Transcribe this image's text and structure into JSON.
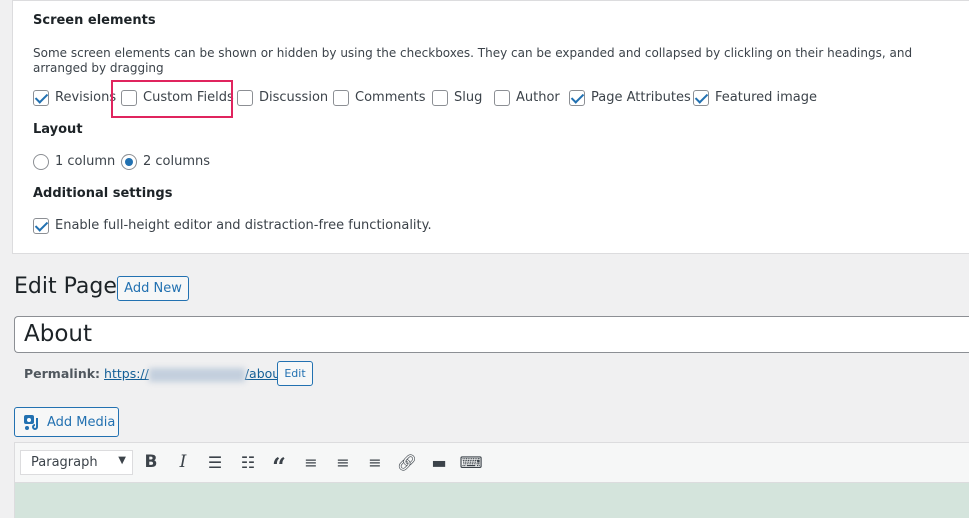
{
  "screen_options": {
    "title": "Screen elements",
    "description": "Some screen elements can be shown or hidden by using the checkboxes. They can be expanded and collapsed by clickling on their headings, and arranged by dragging",
    "elements": [
      {
        "label": "Revisions",
        "checked": true
      },
      {
        "label": "Custom Fields",
        "checked": false,
        "highlighted": true
      },
      {
        "label": "Discussion",
        "checked": false
      },
      {
        "label": "Comments",
        "checked": false
      },
      {
        "label": "Slug",
        "checked": false
      },
      {
        "label": "Author",
        "checked": false
      },
      {
        "label": "Page Attributes",
        "checked": true
      },
      {
        "label": "Featured image",
        "checked": true
      }
    ],
    "layout_title": "Layout",
    "layout_options": [
      {
        "label": "1 column",
        "selected": false
      },
      {
        "label": "2 columns",
        "selected": true
      }
    ],
    "additional_title": "Additional settings",
    "additional": {
      "label": "Enable full-height editor and distraction-free functionality.",
      "checked": true
    }
  },
  "editor": {
    "heading": "Edit Page",
    "add_new": "Add New",
    "title_value": "About",
    "permalink_label": "Permalink:",
    "permalink_prefix": "https://",
    "permalink_suffix": "/about/",
    "edit_label": "Edit",
    "add_media": "Add Media",
    "format_select": "Paragraph",
    "toolbar_icons": [
      "bold-icon",
      "italic-icon",
      "bulleted-list-icon",
      "numbered-list-icon",
      "blockquote-icon",
      "align-left-icon",
      "align-center-icon",
      "align-right-icon",
      "link-icon",
      "read-more-icon",
      "toolbar-toggle-icon"
    ]
  },
  "colors": {
    "accent": "#2271b1",
    "highlight": "#e0245e",
    "content_bg": "#d4e4dc"
  }
}
